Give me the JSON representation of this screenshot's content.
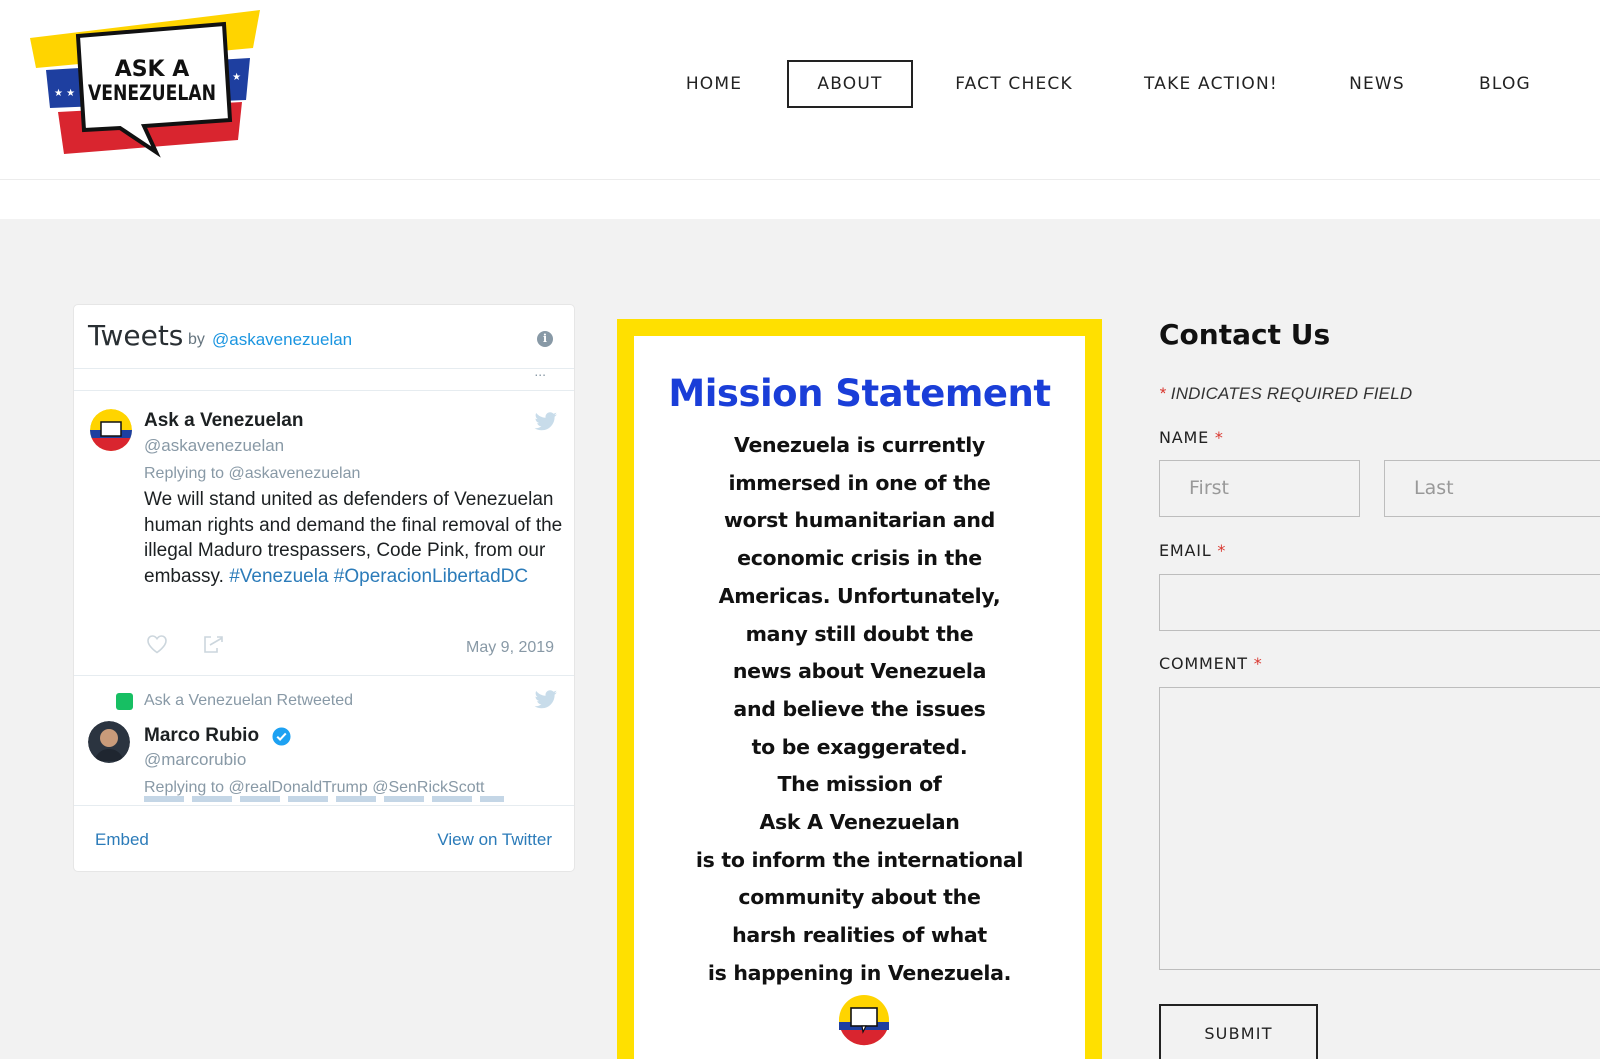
{
  "brand": {
    "logo_line1": "ASK A",
    "logo_line2": "VENEZUELAN"
  },
  "nav": {
    "items": [
      {
        "label": "HOME"
      },
      {
        "label": "ABOUT",
        "active": true
      },
      {
        "label": "FACT CHECK"
      },
      {
        "label": "TAKE ACTION!"
      },
      {
        "label": "NEWS"
      },
      {
        "label": "BLOG"
      }
    ]
  },
  "twitter": {
    "title": "Tweets",
    "by": "by",
    "handle_link": "@askavenezuelan",
    "cutoff_text": "...",
    "tweets": [
      {
        "name": "Ask a Venezuelan",
        "handle": "@askavenezuelan",
        "replying": "Replying to @askavenezuelan",
        "text_plain": "We will stand united as defenders of Venezuelan human rights and demand the final removal of the illegal Maduro trespassers, Code Pink, from our embassy.",
        "hashtag1": "#Venezuela",
        "hashtag2": "#OperacionLibertadDC",
        "date": "May 9, 2019"
      },
      {
        "retweeted_label": "Ask a Venezuelan Retweeted",
        "name": "Marco Rubio",
        "handle": "@marcorubio",
        "replying": "Replying to @realDonaldTrump @SenRickScott"
      }
    ],
    "footer_embed": "Embed",
    "footer_view": "View on Twitter"
  },
  "mission": {
    "title": "Mission Statement",
    "lines": [
      "Venezuela is currently",
      "immersed in one of the",
      "worst humanitarian and",
      "economic crisis in the",
      "Americas. Unfortunately,",
      "many still doubt the",
      "news about Venezuela",
      "and believe the issues",
      "to be exaggerated.",
      "The mission of",
      "Ask A Venezuelan",
      "is to inform the international",
      "community about the",
      "harsh realities of what",
      "is happening in Venezuela."
    ]
  },
  "contact": {
    "title": "Contact Us",
    "required_star": "*",
    "required_note": "INDICATES REQUIRED FIELD",
    "name_label": "NAME",
    "first_placeholder": "First",
    "last_placeholder": "Last",
    "email_label": "EMAIL",
    "comment_label": "COMMENT",
    "submit_label": "SUBMIT"
  },
  "colors": {
    "brand_yellow": "#ffe000",
    "mission_blue": "#1a3ed8",
    "twitter_link": "#2b7bb9",
    "required_red": "#d9372f"
  }
}
